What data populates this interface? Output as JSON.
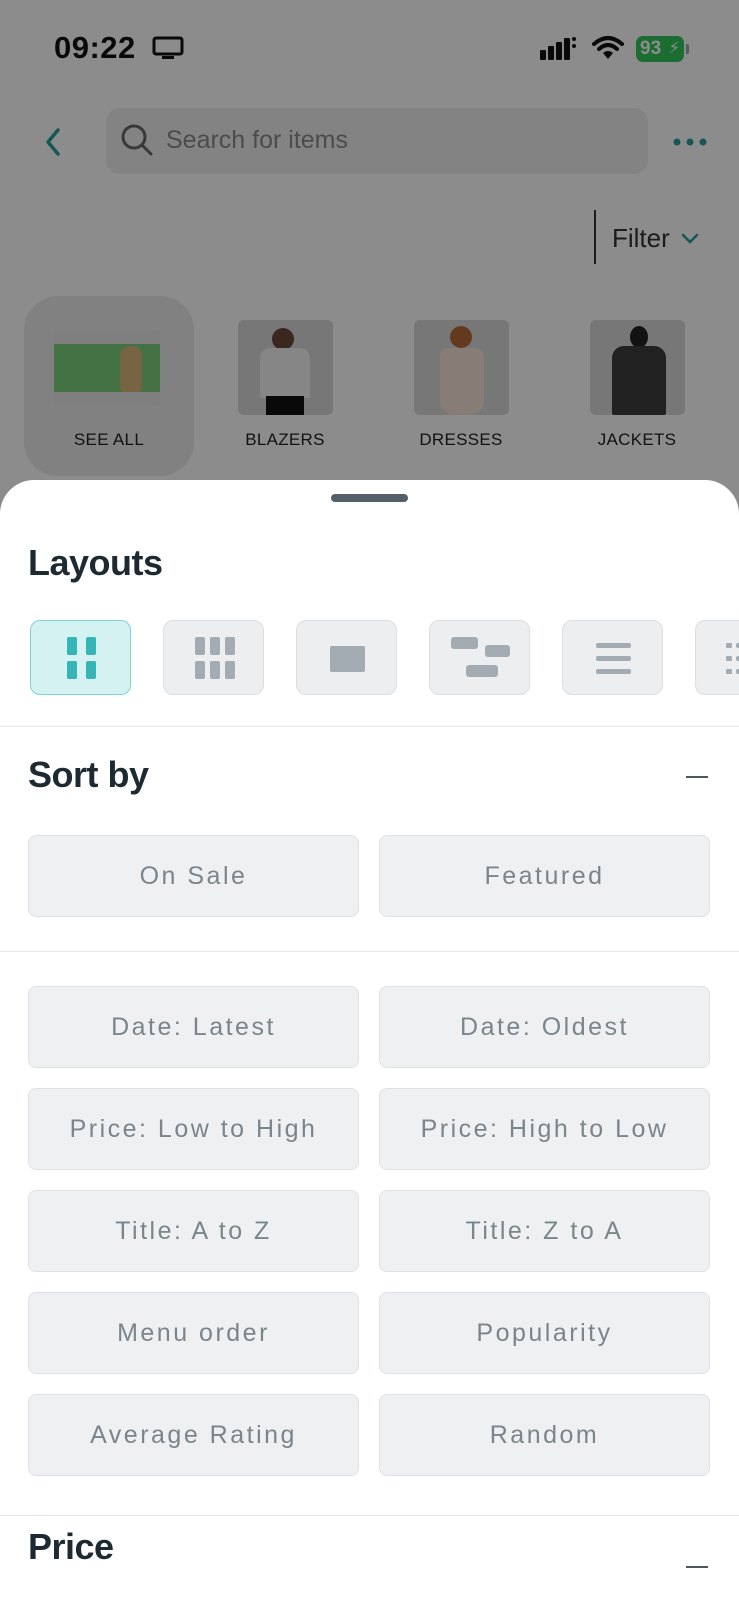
{
  "status_bar": {
    "time": "09:22",
    "battery": "93"
  },
  "header": {
    "search_placeholder": "Search for items",
    "filter_label": "Filter"
  },
  "categories": [
    {
      "label": "SEE ALL",
      "active": true
    },
    {
      "label": "BLAZERS",
      "active": false
    },
    {
      "label": "DRESSES",
      "active": false
    },
    {
      "label": "JACKETS",
      "active": false
    }
  ],
  "sheet": {
    "layouts_title": "Layouts",
    "layouts": [
      {
        "icon": "grid-2-col-icon",
        "active": true
      },
      {
        "icon": "grid-3-col-icon",
        "active": false
      },
      {
        "icon": "single-card-icon",
        "active": false
      },
      {
        "icon": "masonry-icon",
        "active": false
      },
      {
        "icon": "list-icon",
        "active": false
      },
      {
        "icon": "detailed-list-icon",
        "active": false
      }
    ],
    "sort_title": "Sort by",
    "sort_primary": [
      "On Sale",
      "Featured"
    ],
    "sort_options": [
      "Date: Latest",
      "Date: Oldest",
      "Price: Low to High",
      "Price: High to Low",
      "Title: A to Z",
      "Title: Z to A",
      "Menu order",
      "Popularity",
      "Average Rating",
      "Random"
    ],
    "price_title": "Price"
  },
  "colors": {
    "accent": "#35b5b5",
    "accent_bg": "#d4f2f2",
    "battery": "#34c759"
  }
}
